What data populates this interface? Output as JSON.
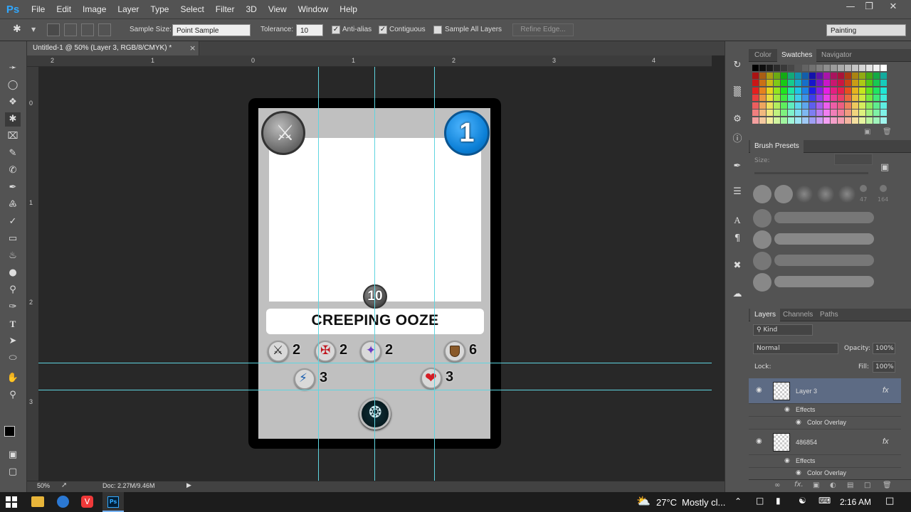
{
  "app": {
    "logo": "Ps"
  },
  "menu": [
    "File",
    "Edit",
    "Image",
    "Layer",
    "Type",
    "Select",
    "Filter",
    "3D",
    "View",
    "Window",
    "Help"
  ],
  "options": {
    "sample_size_label": "Sample Size:",
    "sample_size_value": "Point Sample",
    "tolerance_label": "Tolerance:",
    "tolerance_value": "10",
    "antialias_label": "Anti-alias",
    "contiguous_label": "Contiguous",
    "sample_all_label": "Sample All Layers",
    "refine_edge_label": "Refine Edge...",
    "workspace": "Painting"
  },
  "document": {
    "tab_title": "Untitled-1 @ 50% (Layer 3, RGB/8/CMYK) *",
    "close_glyph": "×"
  },
  "ruler_top": [
    "2",
    "1",
    "0",
    "1",
    "2",
    "3",
    "4"
  ],
  "ruler_left": [
    "0",
    "1",
    "2",
    "3"
  ],
  "status": {
    "zoom": "50%",
    "doc": "Doc: 2.27M/9.46M"
  },
  "card": {
    "name": "CREEPING OOZE",
    "level": "1",
    "center_value": "10",
    "stats": {
      "melee": "2",
      "ranged": "2",
      "magic": "2",
      "armor": "6",
      "speed": "3",
      "health": "3"
    }
  },
  "swatches_panel": {
    "tabs": [
      "Color",
      "Swatches",
      "Navigator"
    ],
    "active": "Swatches"
  },
  "brush_presets": {
    "title": "Brush Presets",
    "size_label": "Size:",
    "tip_sizes": [
      "47",
      "164"
    ]
  },
  "layers_panel": {
    "tabs": [
      "Layers",
      "Channels",
      "Paths"
    ],
    "kind_label": "Kind",
    "blend_mode": "Normal",
    "opacity_label": "Opacity:",
    "opacity_value": "100%",
    "lock_label": "Lock:",
    "fill_label": "Fill:",
    "fill_value": "100%",
    "layers": [
      {
        "name": "Layer 3",
        "effects_label": "Effects",
        "effect": "Color Overlay",
        "fx": "fx"
      },
      {
        "name": "486854",
        "effects_label": "Effects",
        "effect": "Color Overlay",
        "fx": "fx"
      }
    ]
  },
  "taskbar": {
    "temperature": "27°C",
    "weather": "Mostly cl...",
    "time": "2:16 AM"
  }
}
